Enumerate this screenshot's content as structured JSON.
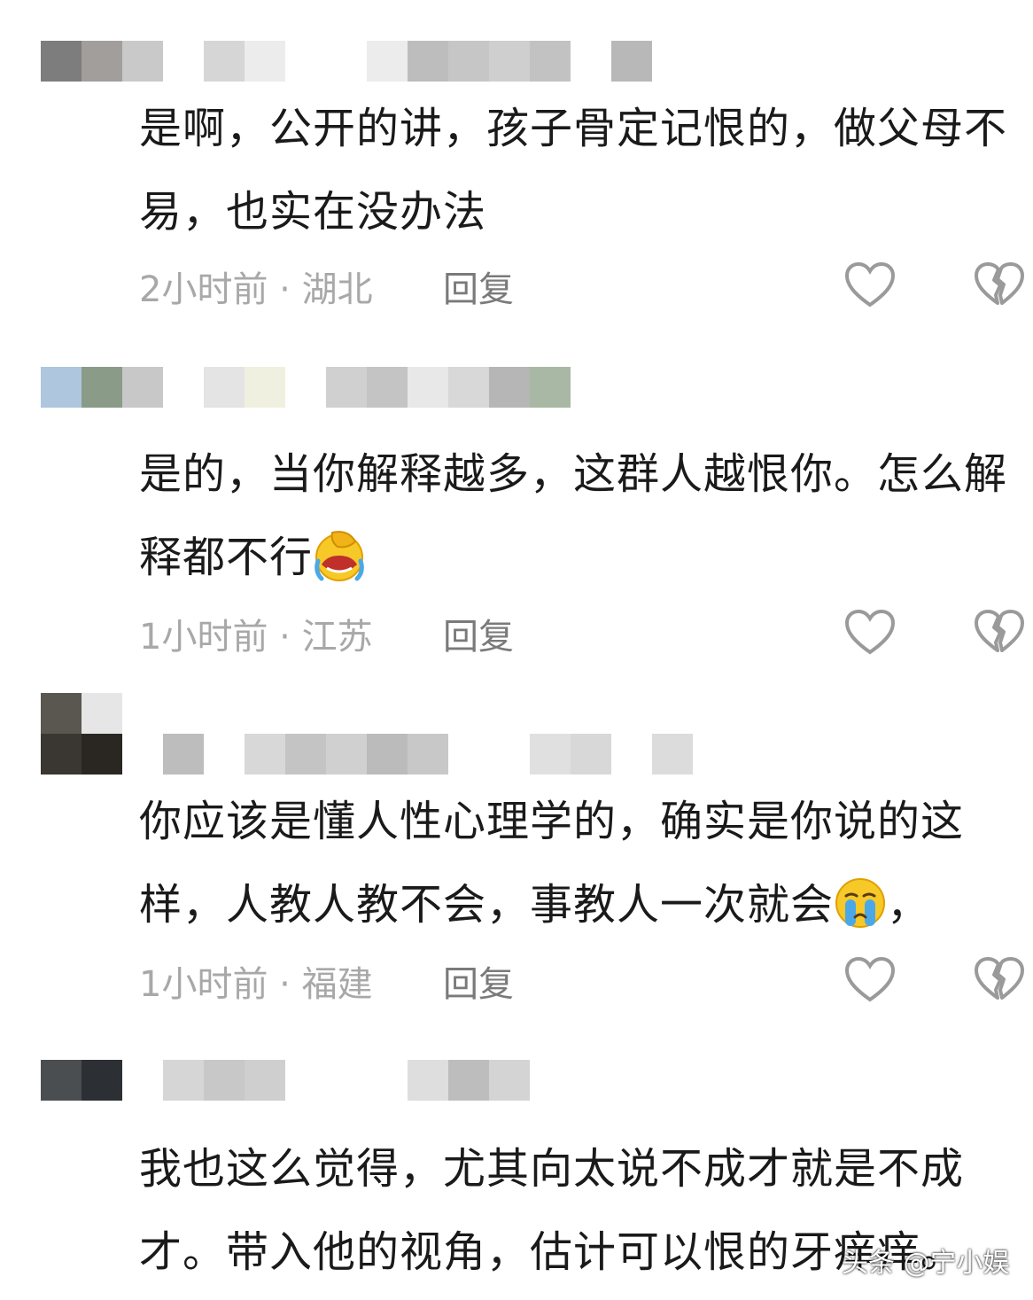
{
  "comments": [
    {
      "text": "是啊，公开的讲，孩子骨定记恨的，做父母不易，也实在没办法",
      "time": "2小时前",
      "location": "湖北",
      "reply_label": "回复"
    },
    {
      "text": "是的，当你解释越多，这群人越恨你。怎么解释都不行",
      "emoji": "face-palm-crying-emoji",
      "time": "1小时前",
      "location": "江苏",
      "reply_label": "回复"
    },
    {
      "text": "你应该是懂人性心理学的，确实是你说的这样，人教人教不会，事教人一次就会",
      "emoji": "crying-emoji",
      "text_tail": "，",
      "time": "1小时前",
      "location": "福建",
      "reply_label": "回复"
    },
    {
      "text": "我也这么觉得，尤其向太说不成才就是不成才。带入他的视角，估计可以恨的牙痒痒。"
    }
  ],
  "separator": " · ",
  "watermark": "头条 @宁小娱",
  "colors": {
    "text": "#1a1a1a",
    "meta": "#a8a8a8",
    "reply": "#7a7a7a",
    "icon": "#9a9a9a"
  }
}
